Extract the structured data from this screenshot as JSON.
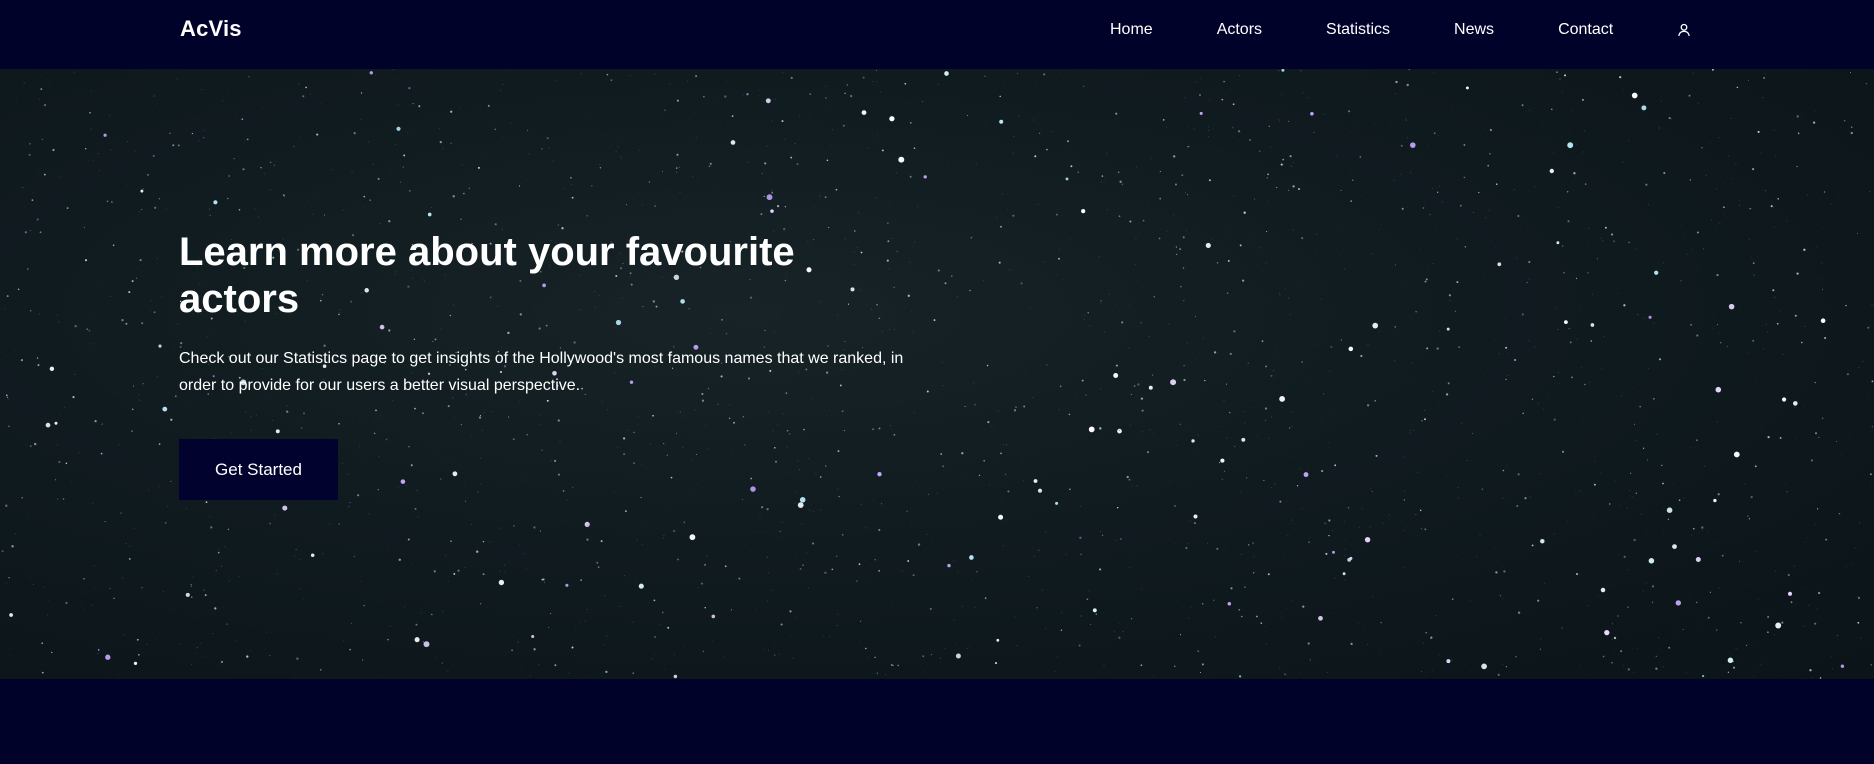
{
  "header": {
    "logo": "AcVis",
    "nav": [
      {
        "label": "Home"
      },
      {
        "label": "Actors"
      },
      {
        "label": "Statistics"
      },
      {
        "label": "News"
      },
      {
        "label": "Contact"
      }
    ],
    "account_icon": "user-icon"
  },
  "hero": {
    "title": "Learn more about your favourite actors",
    "subtitle": "Check out our Statistics page to get insights of the Hollywood's most famous names that we ranked, in order to provide for our users a better visual perspective.",
    "cta_label": "Get Started",
    "background": "starfield"
  },
  "colors": {
    "navy": "#00022a",
    "button": "#02022e",
    "sky": "#101b20",
    "text": "#ffffff"
  }
}
